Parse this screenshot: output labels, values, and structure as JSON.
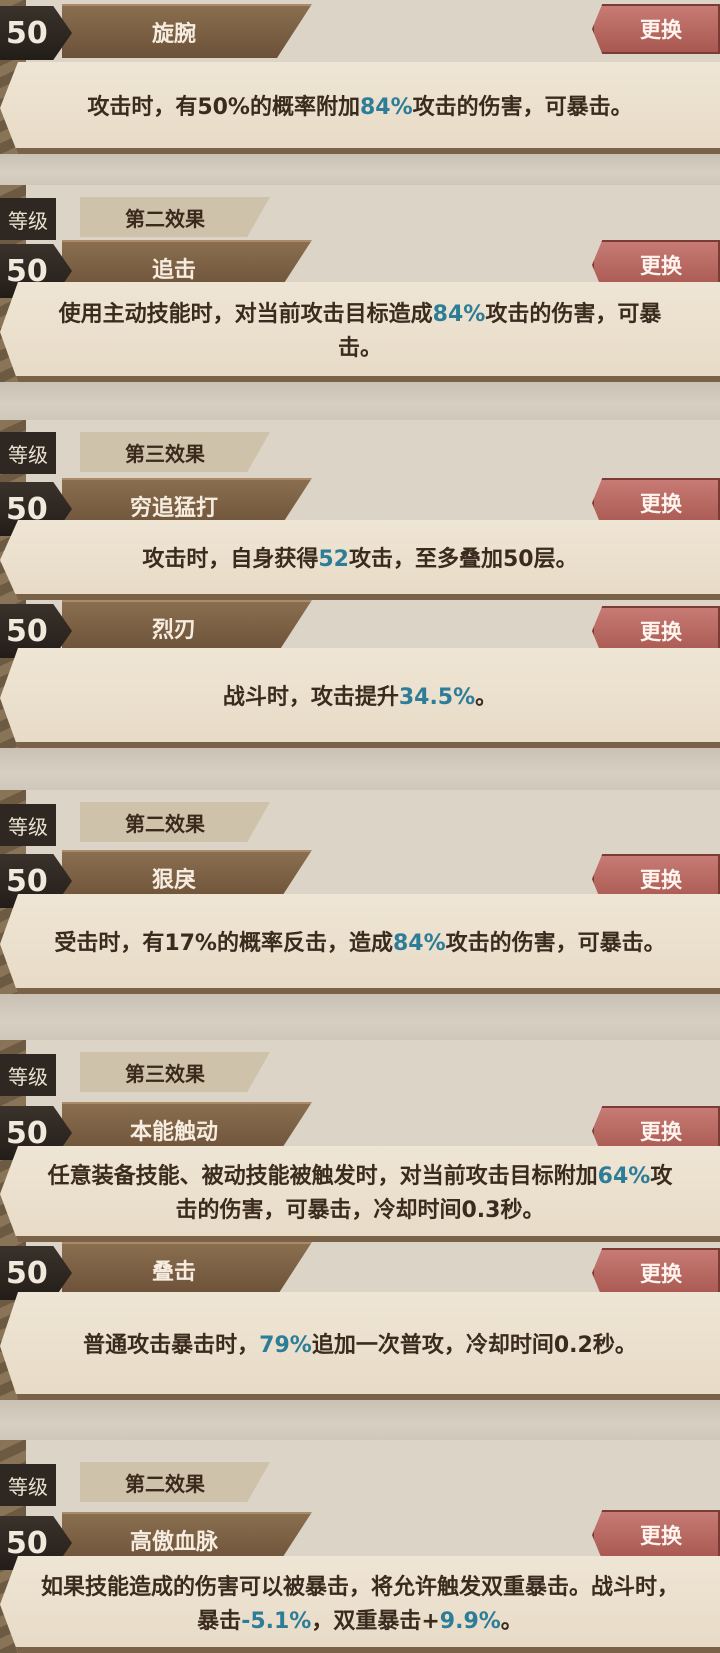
{
  "swap_label": "更换",
  "level_label": "等级",
  "cards": [
    {
      "level": "50",
      "effect_slot": "",
      "skill_name": "旋腕",
      "desc_parts": [
        [
          "攻击时，有50%的概率附加",
          false
        ],
        [
          "84%",
          true
        ],
        [
          "攻击的伤害，可暴击。",
          false
        ]
      ]
    },
    {
      "level": "50",
      "effect_slot": "第二效果",
      "skill_name": "追击",
      "desc_parts": [
        [
          "使用主动技能时，对当前攻击目标造成",
          false
        ],
        [
          "84%",
          true
        ],
        [
          "攻击的伤害，可暴击。",
          false
        ]
      ]
    },
    {
      "level": "50",
      "effect_slot": "第三效果",
      "skill_name": "穷追猛打",
      "desc_parts": [
        [
          "攻击时，自身获得",
          false
        ],
        [
          "52",
          true
        ],
        [
          "攻击，至多叠加50层。",
          false
        ]
      ]
    },
    {
      "level": "50",
      "effect_slot": "",
      "skill_name": "烈刃",
      "desc_parts": [
        [
          "战斗时，攻击提升",
          false
        ],
        [
          "34.5%",
          true
        ],
        [
          "。",
          false
        ]
      ]
    },
    {
      "level": "50",
      "effect_slot": "第二效果",
      "skill_name": "狠戾",
      "desc_parts": [
        [
          "受击时，有17%的概率反击，造成",
          false
        ],
        [
          "84%",
          true
        ],
        [
          "攻击的伤害，可暴击。",
          false
        ]
      ]
    },
    {
      "level": "50",
      "effect_slot": "第三效果",
      "skill_name": "本能触动",
      "desc_parts": [
        [
          "任意装备技能、被动技能被触发时，对当前攻击目标附加",
          false
        ],
        [
          "64%",
          true
        ],
        [
          "攻击的伤害，可暴击，冷却时间0.3秒。",
          false
        ]
      ]
    },
    {
      "level": "50",
      "effect_slot": "",
      "skill_name": "叠击",
      "desc_parts": [
        [
          "普通攻击暴击时，",
          false
        ],
        [
          "79%",
          true
        ],
        [
          "追加一次普攻，冷却时间0.2秒。",
          false
        ]
      ]
    },
    {
      "level": "50",
      "effect_slot": "第二效果",
      "skill_name": "高傲血脉",
      "desc_parts": [
        [
          "如果技能造成的伤害可以被暴击，将允许触发双重暴击。战斗时，暴击",
          false
        ],
        [
          "-5.1%",
          true
        ],
        [
          "，双重暴击+",
          false
        ],
        [
          "9.9%",
          true
        ],
        [
          "。",
          false
        ]
      ]
    }
  ]
}
